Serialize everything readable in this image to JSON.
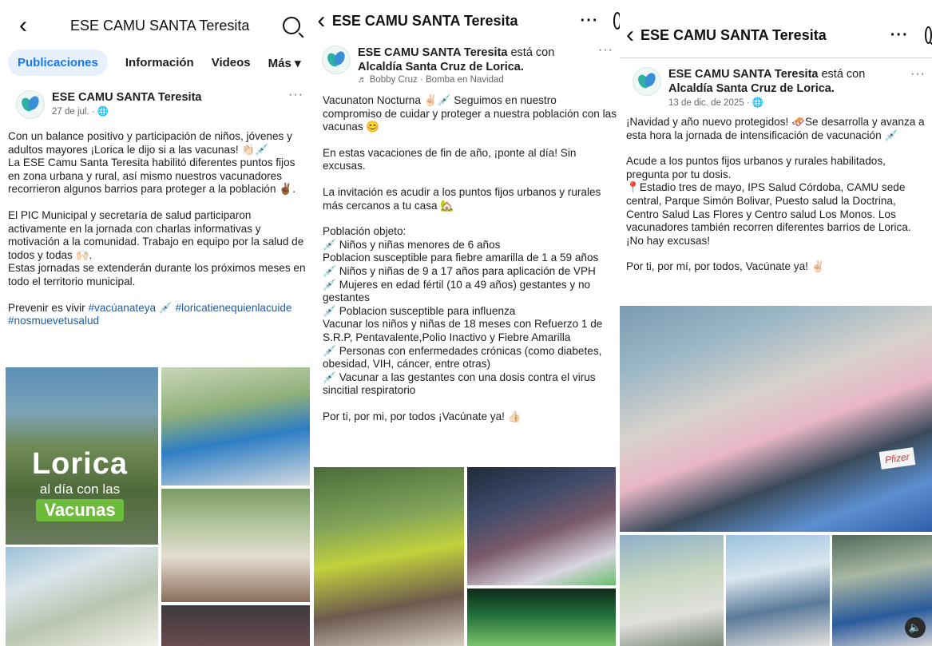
{
  "panel1": {
    "header": {
      "title": "ESE CAMU SANTA Teresita"
    },
    "tabs": [
      "Publicaciones",
      "Información",
      "Videos",
      "Más ▾"
    ],
    "post": {
      "author": "ESE CAMU SANTA Teresita",
      "date": "27 de jul. · 🌐",
      "paragraphs": [
        "Con un balance positivo y participación de niños, jóvenes y adultos mayores ¡Lorica le dijo si a las vacunas! 👏🏻💉",
        "La ESE Camu Santa Teresita habilitó diferentes puntos fijos en zona urbana y rural, así mismo nuestros vacunadores recorrieron algunos barrios  para proteger a la población ✌🏾.",
        "",
        "El PIC Municipal y secretaría de salud participaron activamente en la jornada con charlas informativas y motivación a la comunidad. Trabajo en equipo por la salud de todos y todas 🙌🏻.",
        "Estas jornadas se extenderán durante los próximos meses en todo el territorio municipal.",
        ""
      ],
      "hashtag_line_prefix": "Prevenir es vivir ",
      "hashtags": [
        "#vacúanateya",
        "💉",
        "#loricatienequienlacuide",
        "#nosmuevetusalud"
      ],
      "image_overlay": {
        "line1": "Lorica",
        "line2": "al día con las",
        "line3": "Vacunas"
      }
    }
  },
  "panel2": {
    "header": {
      "title": "ESE CAMU SANTA Teresita"
    },
    "post": {
      "author": "ESE CAMU SANTA Teresita",
      "with_text": " está con ",
      "page": "Alcaldía Santa Cruz de Lorica",
      "music": "♬ Bobby Cruz · Bomba en Navidad",
      "lines": [
        "Vacunaton Nocturna ✌🏻💉 Seguimos en nuestro compromiso de cuidar y proteger a nuestra población con las vacunas 😊",
        "",
        "En estas vacaciones de fin de año, ¡ponte al día!  Sin excusas.",
        "",
        "La invitación es acudir a los puntos fijos urbanos y rurales más cercanos a tu casa 🏡",
        "",
        "Población objeto:",
        "💉 Niños y niñas menores de 6 años",
        "Poblacion susceptible para fiebre amarilla de 1 a 59 años",
        "💉 Niños y niñas de 9 a 17 años para aplicación de VPH",
        "💉 Mujeres en edad fértil (10 a 49 años) gestantes y no gestantes",
        "💉 Poblacion susceptible para influenza",
        "Vacunar los niños y niñas de 18 meses con Refuerzo 1 de S.R.P, Pentavalente,Polio Inactivo y Fiebre Amarilla",
        "💉 Personas con enfermedades crónicas (como diabetes, obesidad, VIH, cáncer, entre otras)",
        "💉 Vacunar a las gestantes con una dosis contra el virus sincitial respiratorio",
        "",
        "Por ti, por mi, por todos ¡Vacúnate ya! 👍🏻"
      ]
    }
  },
  "panel3": {
    "header": {
      "title": "ESE CAMU SANTA Teresita"
    },
    "post": {
      "author": "ESE CAMU SANTA Teresita",
      "with_text": " está con ",
      "page": "Alcaldía Santa Cruz de Lorica",
      "date": "13 de dic. de 2025 · 🌐",
      "lines": [
        "¡Navidad y año nuevo protegidos!  🛷Se desarrolla y avanza a esta hora la jornada de intensificación de vacunación 💉",
        "",
        "Acude a los puntos fijos urbanos y rurales habilitados, pregunta por tu dosis.",
        "📍Estadio  tres de mayo, IPS Salud Córdoba, CAMU sede central, Parque Simón Bolivar, Puesto salud la Doctrina, Centro Salud Las Flores y Centro salud Los Monos. Los vacunadores también recorren diferentes barrios de Lorica. ¡No hay excusas!",
        "",
        "Por ti, por mí, por todos, Vacúnate ya! ✌🏻"
      ],
      "image_sign": "Pfizer"
    }
  },
  "icons": {
    "back": "‹",
    "more": "···",
    "sound": "🔈"
  }
}
